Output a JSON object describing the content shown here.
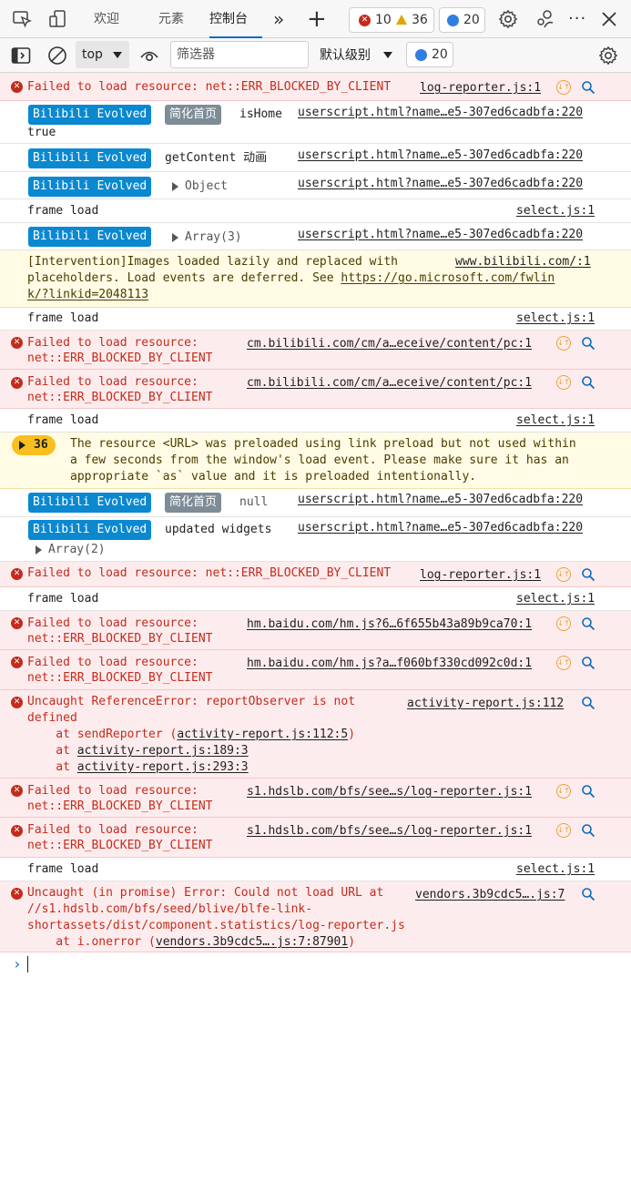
{
  "tabbar": {
    "tabs": [
      "欢迎",
      "元素",
      "控制台"
    ],
    "active_tab": "控制台",
    "more_tabs": "»",
    "add_tab": "+",
    "error_count": "10",
    "warning_count": "36",
    "message_count": "20",
    "more_options": "···"
  },
  "toolbar": {
    "context": "top",
    "filter_placeholder": "筛选器",
    "level": "默认级别",
    "message_count": "20"
  },
  "messages": {
    "m1": {
      "text": "Failed to load resource: net::ERR_BLOCKED_BY_CLIENT",
      "source": "log-reporter.js:1"
    },
    "m2": {
      "tag": "Bilibili Evolved",
      "tag2": "简化首页",
      "text": "isHome",
      "text2": "true",
      "source": "userscript.html?name…e5-307ed6cadbfa:220"
    },
    "m3": {
      "tag": "Bilibili Evolved",
      "text": "getContent 动画",
      "source": "userscript.html?name…e5-307ed6cadbfa:220"
    },
    "m4": {
      "tag": "Bilibili Evolved",
      "text": "Object",
      "source": "userscript.html?name…e5-307ed6cadbfa:220"
    },
    "m5": {
      "text": "frame load",
      "source": "select.js:1"
    },
    "m6": {
      "tag": "Bilibili Evolved",
      "text": "Array(3)",
      "source": "userscript.html?name…e5-307ed6cadbfa:220"
    },
    "m7": {
      "line1": "[Intervention]Images loaded lazily and replaced with",
      "line2": "placeholders. Load events are deferred. See ",
      "line2_link": "https://go.microsoft.com/fwlin",
      "line3": "k/?linkid=2048113",
      "source": "www.bilibili.com/:1"
    },
    "m8": {
      "text": "frame load",
      "source": "select.js:1"
    },
    "m9": {
      "line1": "Failed to load resource:",
      "line2": "net::ERR_BLOCKED_BY_CLIENT",
      "source": "cm.bilibili.com/cm/a…eceive/content/pc:1"
    },
    "m10": {
      "line1": "Failed to load resource:",
      "line2": "net::ERR_BLOCKED_BY_CLIENT",
      "source": "cm.bilibili.com/cm/a…eceive/content/pc:1"
    },
    "m11": {
      "text": "frame load",
      "source": "select.js:1"
    },
    "m12": {
      "count": "36",
      "line1": "The resource <URL> was preloaded using link preload but not used within",
      "line2": "a few seconds from the window's load event. Please make sure it has an",
      "line3": "appropriate `as` value and it is preloaded intentionally."
    },
    "m13": {
      "tag": "Bilibili Evolved",
      "tag2": "简化首页",
      "text": "null",
      "source": "userscript.html?name…e5-307ed6cadbfa:220"
    },
    "m14": {
      "tag": "Bilibili Evolved",
      "text": "updated widgets",
      "text2": "Array(2)",
      "source": "userscript.html?name…e5-307ed6cadbfa:220"
    },
    "m15": {
      "text": "Failed to load resource: net::ERR_BLOCKED_BY_CLIENT",
      "source": "log-reporter.js:1"
    },
    "m16": {
      "text": "frame load",
      "source": "select.js:1"
    },
    "m17": {
      "line1": "Failed to load resource:",
      "line2": "net::ERR_BLOCKED_BY_CLIENT",
      "source": "hm.baidu.com/hm.js?6…6f655b43a89b9ca70:1"
    },
    "m18": {
      "line1": "Failed to load resource:",
      "line2": "net::ERR_BLOCKED_BY_CLIENT",
      "source": "hm.baidu.com/hm.js?a…f060bf330cd092c0d:1"
    },
    "m19": {
      "line1": "Uncaught ReferenceError: reportObserver is not",
      "line2": "defined",
      "stack1_pre": "    at sendReporter (",
      "stack1_link": "activity-report.js:112:5",
      "stack1_post": ")",
      "stack2_pre": "    at ",
      "stack2_link": "activity-report.js:189:3",
      "stack3_pre": "    at ",
      "stack3_link": "activity-report.js:293:3",
      "source": "activity-report.js:112"
    },
    "m20": {
      "line1": "Failed to load resource:",
      "line2": "net::ERR_BLOCKED_BY_CLIENT",
      "source": "s1.hdslb.com/bfs/see…s/log-reporter.js:1"
    },
    "m21": {
      "line1": "Failed to load resource:",
      "line2": "net::ERR_BLOCKED_BY_CLIENT",
      "source": "s1.hdslb.com/bfs/see…s/log-reporter.js:1"
    },
    "m22": {
      "text": "frame load",
      "source": "select.js:1"
    },
    "m23": {
      "line1": "Uncaught (in promise) Error: Could not load URL at",
      "line2": "//s1.hdslb.com/bfs/seed/blive/blfe-link-",
      "line3": "shortassets/dist/component.statistics/log-reporter.js",
      "stack_pre": "    at i.onerror (",
      "stack_link": "vendors.3b9cdc5….js:7:87901",
      "stack_post": ")",
      "source": "vendors.3b9cdc5….js:7"
    }
  },
  "console_prompt": "›",
  "colors": {
    "error": "#c42b1c",
    "warning": "#f8bf1e",
    "accent": "#0f6cbd",
    "tag": "#0a88d0"
  }
}
